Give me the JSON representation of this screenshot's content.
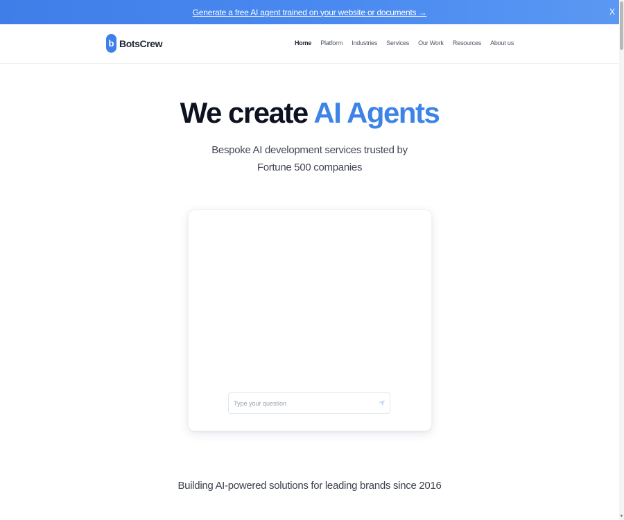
{
  "banner": {
    "link_text": "Generate a free AI agent trained on your website or documents →",
    "close_label": "X",
    "gradient_start": "#3f7de8",
    "gradient_end": "#5a98f3"
  },
  "header": {
    "logo_mark": "b",
    "logo_text": "BotsCrew",
    "nav": [
      {
        "label": "Home",
        "active": true
      },
      {
        "label": "Platform",
        "active": false
      },
      {
        "label": "Industries",
        "active": false
      },
      {
        "label": "Services",
        "active": false
      },
      {
        "label": "Our Work",
        "active": false
      },
      {
        "label": "Resources",
        "active": false
      },
      {
        "label": "About us",
        "active": false
      }
    ]
  },
  "hero": {
    "title_plain": "We create ",
    "title_accent": "AI Agents",
    "subtitle": "Bespoke AI development services trusted by Fortune 500 companies",
    "accent_color": "#3d84e6"
  },
  "chat": {
    "input_placeholder": "Type your question",
    "input_value": "",
    "send_icon": "send-icon"
  },
  "tagline": "Building AI-powered solutions for leading brands since 2016",
  "colors": {
    "brand_blue": "#3f7fe8",
    "text_dark": "#0e1220"
  }
}
